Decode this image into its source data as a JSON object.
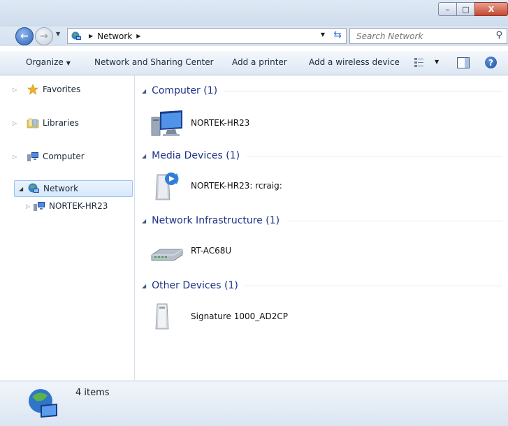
{
  "window": {
    "minimize_label": "–",
    "maximize_label": "□",
    "close_label": "X"
  },
  "address": {
    "back_label": "←",
    "forward_label": "→",
    "breadcrumb": [
      "Network"
    ],
    "search_placeholder": "Search Network"
  },
  "toolbar": {
    "organize": "Organize",
    "network_sharing": "Network and Sharing Center",
    "add_printer": "Add a printer",
    "add_wireless": "Add a wireless device",
    "help_label": "?"
  },
  "nav": {
    "items": [
      {
        "label": "Favorites",
        "icon": "star-icon"
      },
      {
        "label": "Libraries",
        "icon": "libraries-icon"
      },
      {
        "label": "Computer",
        "icon": "computer-icon"
      },
      {
        "label": "Network",
        "icon": "network-icon",
        "selected": true
      },
      {
        "label": "NORTEK-HR23",
        "icon": "computer-icon"
      }
    ]
  },
  "groups": [
    {
      "title": "Computer (1)",
      "items": [
        {
          "label": "NORTEK-HR23",
          "icon": "monitor-icon"
        }
      ]
    },
    {
      "title": "Media Devices (1)",
      "items": [
        {
          "label": "NORTEK-HR23: rcraig:",
          "icon": "media-server-icon"
        }
      ]
    },
    {
      "title": "Network Infrastructure (1)",
      "items": [
        {
          "label": "RT-AC68U",
          "icon": "router-icon"
        }
      ]
    },
    {
      "title": "Other Devices (1)",
      "items": [
        {
          "label": "Signature 1000_AD2CP",
          "icon": "device-tower-icon"
        }
      ]
    }
  ],
  "status": {
    "count": "4 items"
  },
  "colors": {
    "group_title": "#1e3287",
    "selection": "#d7e8fb",
    "close_button": "#c6482f"
  }
}
